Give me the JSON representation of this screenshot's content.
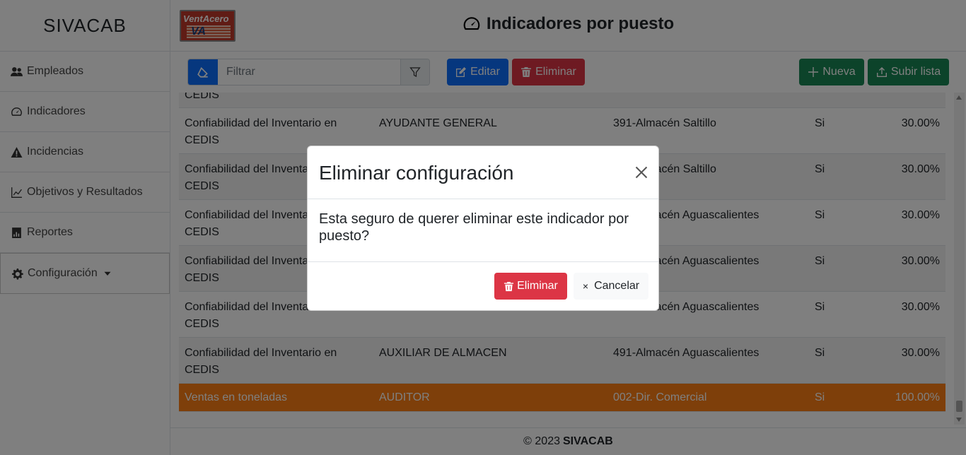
{
  "app": {
    "brand": "SIVACAB",
    "logo_text_top": "VentAcero",
    "logo_text_mark": "VA"
  },
  "header": {
    "title": "Indicadores por puesto",
    "icon": "speedometer-icon"
  },
  "sidebar": {
    "items": [
      {
        "label": "Empleados",
        "icon": "people-icon"
      },
      {
        "label": "Indicadores",
        "icon": "speedometer-icon"
      },
      {
        "label": "Incidencias",
        "icon": "warning-icon"
      },
      {
        "label": "Objetivos y Resultados",
        "icon": "chart-line-icon"
      },
      {
        "label": "Reportes",
        "icon": "bar-chart-icon"
      },
      {
        "label": "Configuración",
        "icon": "gear-icon",
        "caret": "caret-down-icon"
      }
    ]
  },
  "toolbar": {
    "filter_placeholder": "Filtrar",
    "filter_value": "",
    "edit_label": "Editar",
    "delete_label": "Eliminar",
    "new_label": "Nueva",
    "upload_label": "Subir lista"
  },
  "table": {
    "partial_row": {
      "indicator": "CEDIS"
    },
    "rows": [
      {
        "indicator": "Confiabilidad del Inventario en CEDIS",
        "position": "AYUDANTE GENERAL",
        "location": "391-Almacén Saltillo",
        "active": "Si",
        "weight": "30.00%"
      },
      {
        "indicator": "Confiabilidad del Inventario en CEDIS",
        "position": "",
        "location": "391-Almacén Saltillo",
        "active": "Si",
        "weight": "30.00%"
      },
      {
        "indicator": "Confiabilidad del Inventario en CEDIS",
        "position": "",
        "location": "491-Almacén Aguascalientes",
        "active": "Si",
        "weight": "30.00%"
      },
      {
        "indicator": "Confiabilidad del Inventario en CEDIS",
        "position": "",
        "location": "491-Almacén Aguascalientes",
        "active": "Si",
        "weight": "30.00%"
      },
      {
        "indicator": "Confiabilidad del Inventario en CEDIS",
        "position": "",
        "location": "491-Almacén Aguascalientes",
        "active": "Si",
        "weight": "30.00%"
      },
      {
        "indicator": "Confiabilidad del Inventario en CEDIS",
        "position": "AUXILIAR DE ALMACEN",
        "location": "491-Almacén Aguascalientes",
        "active": "Si",
        "weight": "30.00%"
      }
    ],
    "selected_row": {
      "indicator": "Ventas en toneladas",
      "position": "AUDITOR",
      "location": "002-Dir. Comercial",
      "active": "Si",
      "weight": "100.00%"
    }
  },
  "footer": {
    "copyright": "© 2023",
    "brand": "SIVACAB"
  },
  "modal": {
    "title": "Eliminar configuración",
    "body": "Esta seguro de querer eliminar este indicador por puesto?",
    "confirm_label": "Eliminar",
    "cancel_label": "Cancelar",
    "cancel_glyph": "×"
  },
  "colors": {
    "primary": "#0d6efd",
    "danger": "#dc3545",
    "success": "#198754",
    "selected_row": "#fd7e14"
  }
}
